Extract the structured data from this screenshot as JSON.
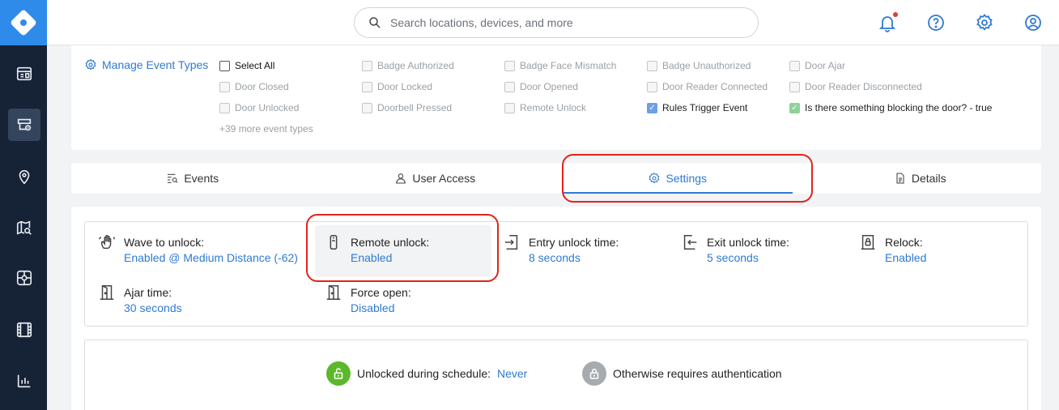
{
  "sidebar": {
    "items": [
      {
        "icon": "card-reader-icon"
      },
      {
        "icon": "access-control-icon",
        "active": true
      },
      {
        "icon": "location-pin-icon"
      },
      {
        "icon": "map-search-icon"
      },
      {
        "icon": "camera-box-icon"
      },
      {
        "icon": "film-icon"
      },
      {
        "icon": "analytics-icon"
      }
    ]
  },
  "header": {
    "search_placeholder": "Search locations, devices, and more",
    "icons": [
      "bell-icon",
      "help-icon",
      "gear-icon",
      "user-icon"
    ]
  },
  "event_types": {
    "manage_label": "Manage Event Types",
    "items": [
      {
        "label": "Select All",
        "state": "enabled"
      },
      {
        "label": "Badge Authorized",
        "state": "disabled"
      },
      {
        "label": "Badge Face Mismatch",
        "state": "disabled"
      },
      {
        "label": "Badge Unauthorized",
        "state": "disabled"
      },
      {
        "label": "Door Ajar",
        "state": "disabled"
      },
      {
        "label": "Door Closed",
        "state": "disabled"
      },
      {
        "label": "Door Locked",
        "state": "disabled"
      },
      {
        "label": "Door Opened",
        "state": "disabled"
      },
      {
        "label": "Door Reader Connected",
        "state": "disabled"
      },
      {
        "label": "Door Reader Disconnected",
        "state": "disabled"
      },
      {
        "label": "Door Unlocked",
        "state": "disabled"
      },
      {
        "label": "Doorbell Pressed",
        "state": "disabled"
      },
      {
        "label": "Remote Unlock",
        "state": "disabled"
      },
      {
        "label": "Rules Trigger Event",
        "state": "checked"
      },
      {
        "label": "Is there something blocking the door? - true",
        "state": "checked"
      }
    ],
    "more_label": "+39 more event types"
  },
  "tabs": [
    {
      "label": "Events",
      "icon": "events-list-icon"
    },
    {
      "label": "User Access",
      "icon": "user-icon"
    },
    {
      "label": "Settings",
      "icon": "gear-icon",
      "active": true
    },
    {
      "label": "Details",
      "icon": "document-icon"
    }
  ],
  "settings": {
    "wave": {
      "label": "Wave to unlock:",
      "value": "Enabled @ Medium Distance (-62)"
    },
    "remote": {
      "label": "Remote unlock:",
      "value": "Enabled"
    },
    "entry": {
      "label": "Entry unlock time:",
      "value": "8 seconds"
    },
    "exit": {
      "label": "Exit unlock time:",
      "value": "5 seconds"
    },
    "relock": {
      "label": "Relock:",
      "value": "Enabled"
    },
    "ajar": {
      "label": "Ajar time:",
      "value": "30 seconds"
    },
    "force": {
      "label": "Force open:",
      "value": "Disabled"
    }
  },
  "schedule": {
    "unlocked_label": "Unlocked during schedule:",
    "unlocked_value": "Never",
    "otherwise_label": "Otherwise requires authentication",
    "colors": {
      "unlocked": "#5cb82b",
      "otherwise": "#a7abb0"
    }
  },
  "colors": {
    "accent": "#2f7ad1",
    "sidebar": "#162236",
    "highlight": "#e0241b"
  }
}
